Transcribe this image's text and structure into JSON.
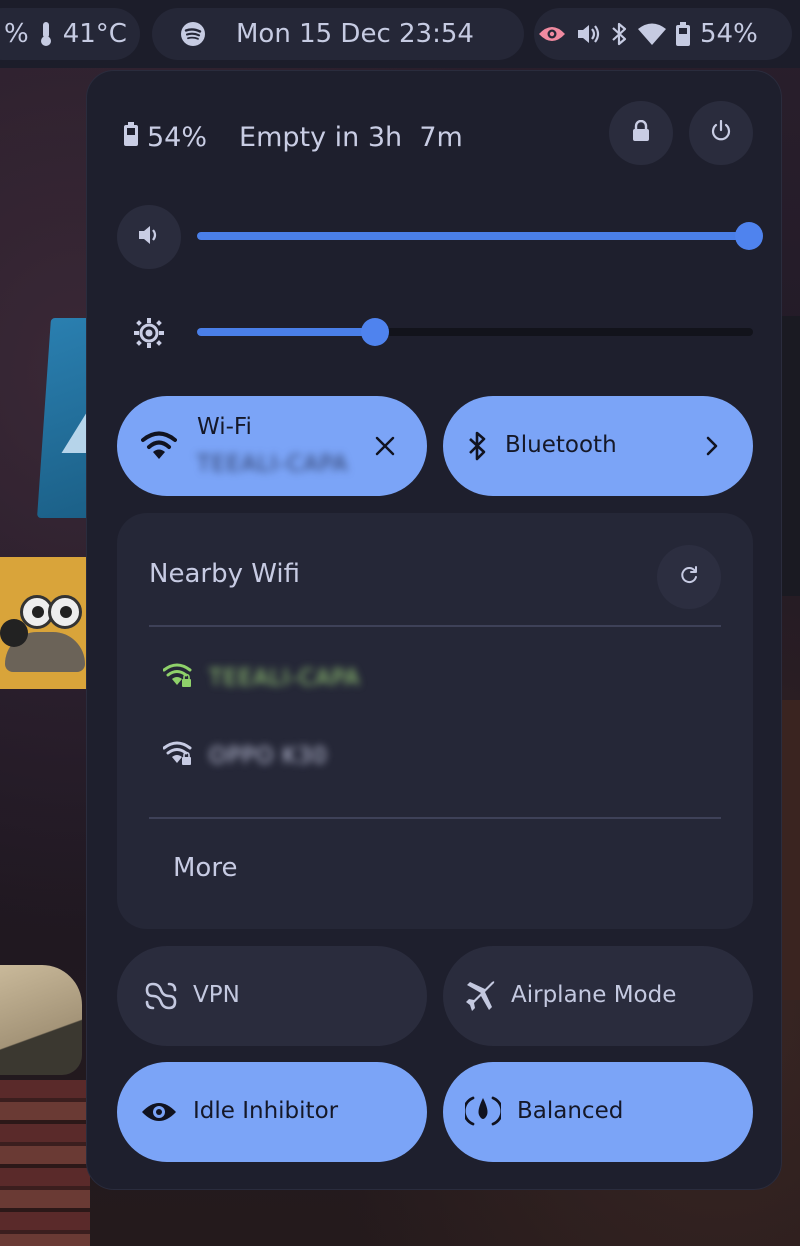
{
  "topbar": {
    "left_percent": "%",
    "temperature": "41°C",
    "clock": "Mon 15 Dec 23:54",
    "battery": "54%",
    "icons": [
      "thermometer-icon",
      "spotify-icon",
      "eye-icon",
      "volume-icon",
      "bluetooth-icon",
      "wifi-icon",
      "battery-icon"
    ]
  },
  "panel": {
    "battery_percent": "54%",
    "battery_time": "Empty in 3h  7m",
    "volume_level": 1.0,
    "brightness_level": 0.32,
    "tiles": {
      "wifi": {
        "label": "Wi-Fi",
        "network": "TEEALI-CAPA",
        "active": true
      },
      "bluetooth": {
        "label": "Bluetooth",
        "active": true
      },
      "vpn": {
        "label": "VPN",
        "active": false
      },
      "airplane": {
        "label": "Airplane Mode",
        "active": false
      },
      "idle": {
        "label": "Idle Inhibitor",
        "active": true
      },
      "power_profile": {
        "label": "Balanced",
        "active": true
      }
    },
    "nearby": {
      "title": "Nearby Wifi",
      "networks": [
        {
          "name": "TEEALI-CAPA",
          "connected": true
        },
        {
          "name": "OPPO K30",
          "connected": false
        }
      ],
      "more_label": "More"
    }
  },
  "colors": {
    "accent": "#7ba4f7",
    "slider": "#4a7fe8",
    "panel_bg": "#1e1f2d",
    "connected_wifi": "#8fd16a",
    "eye_red": "#f08aa0"
  }
}
